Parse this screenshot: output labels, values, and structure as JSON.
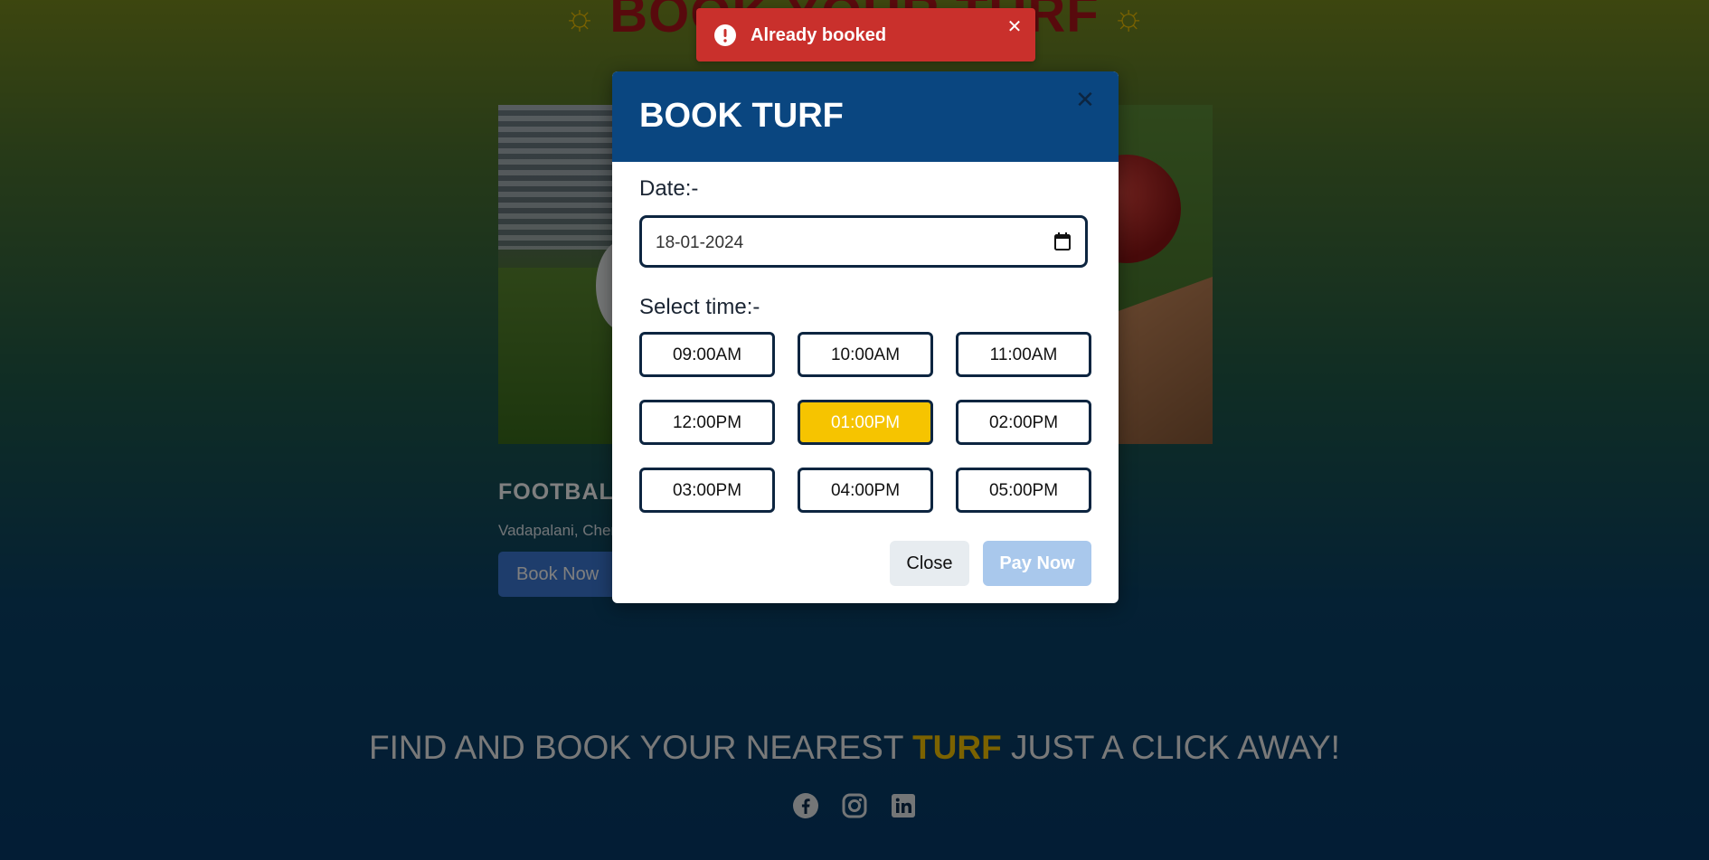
{
  "page": {
    "title": "BOOK YOUR TURF",
    "title_icon": "sun-icon",
    "tagline": {
      "before": "FIND AND BOOK YOUR NEAREST ",
      "accent": "TURF",
      "after": " JUST A CLICK AWAY!"
    },
    "social_icons": [
      "facebook-icon",
      "instagram-icon",
      "linkedin-icon"
    ]
  },
  "card": {
    "title": "FOOTBALL",
    "location": "Vadapalani, Cher",
    "button_label": "Book Now"
  },
  "modal": {
    "title": "BOOK TURF",
    "date_label": "Date:-",
    "date_value": "18-01-2024",
    "time_label": "Select time:-",
    "slots": [
      {
        "label": "09:00AM",
        "selected": false
      },
      {
        "label": "10:00AM",
        "selected": false
      },
      {
        "label": "11:00AM",
        "selected": false
      },
      {
        "label": "12:00PM",
        "selected": false
      },
      {
        "label": "01:00PM",
        "selected": true
      },
      {
        "label": "02:00PM",
        "selected": false
      },
      {
        "label": "03:00PM",
        "selected": false
      },
      {
        "label": "04:00PM",
        "selected": false
      },
      {
        "label": "05:00PM",
        "selected": false
      }
    ],
    "close_label": "Close",
    "pay_label": "Pay Now"
  },
  "toast": {
    "message": "Already booked",
    "icon": "error-icon"
  },
  "colors": {
    "accent": "#f6c400",
    "modal_header": "#0a4680",
    "toast_error": "#c9302c",
    "pay_button": "#a9c8ec"
  }
}
